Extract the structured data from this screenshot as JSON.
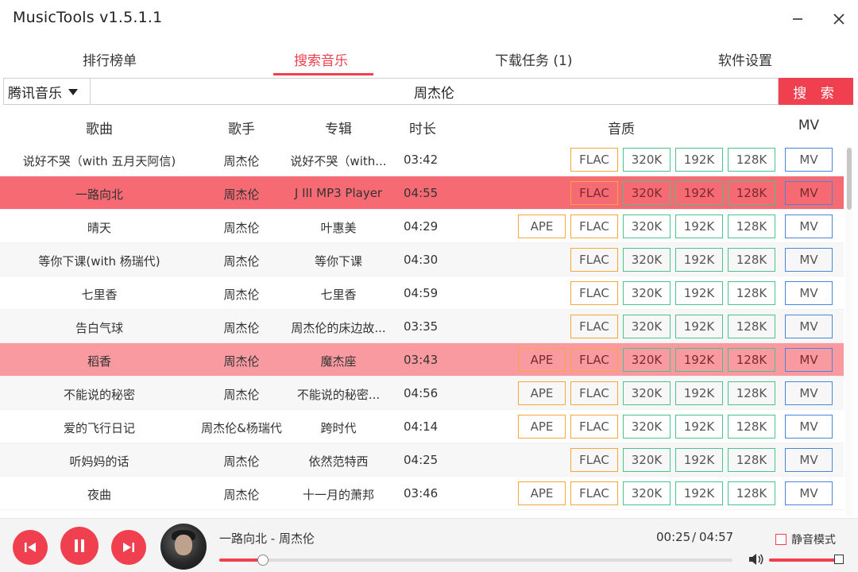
{
  "app": {
    "title": "MusicTools v1.5.1.1"
  },
  "tabs": [
    {
      "label": "排行榜单"
    },
    {
      "label": "搜索音乐",
      "active": true
    },
    {
      "label": "下载任务 (1)"
    },
    {
      "label": "软件设置"
    }
  ],
  "search": {
    "source": "腾讯音乐",
    "query": "周杰伦",
    "button_label": "搜 索"
  },
  "columns": {
    "song": "歌曲",
    "artist": "歌手",
    "album": "专辑",
    "duration": "时长",
    "quality": "音质",
    "mv": "MV"
  },
  "quality_labels": {
    "ape": "APE",
    "flac": "FLAC",
    "q320": "320K",
    "q192": "192K",
    "q128": "128K",
    "mv": "MV"
  },
  "songs": [
    {
      "song": "说好不哭（with 五月天阿信)",
      "artist": "周杰伦",
      "album": "说好不哭（with...",
      "duration": "03:42",
      "ape": false,
      "highlight": "none"
    },
    {
      "song": "一路向北",
      "artist": "周杰伦",
      "album": "J III MP3 Player",
      "duration": "04:55",
      "ape": false,
      "highlight": "strong"
    },
    {
      "song": "晴天",
      "artist": "周杰伦",
      "album": "叶惠美",
      "duration": "04:29",
      "ape": true,
      "highlight": "none"
    },
    {
      "song": "等你下课(with 杨瑞代)",
      "artist": "周杰伦",
      "album": "等你下课",
      "duration": "04:30",
      "ape": false,
      "highlight": "none"
    },
    {
      "song": "七里香",
      "artist": "周杰伦",
      "album": "七里香",
      "duration": "04:59",
      "ape": false,
      "highlight": "none"
    },
    {
      "song": "告白气球",
      "artist": "周杰伦",
      "album": "周杰伦的床边故...",
      "duration": "03:35",
      "ape": false,
      "highlight": "none"
    },
    {
      "song": "稻香",
      "artist": "周杰伦",
      "album": "魔杰座",
      "duration": "03:43",
      "ape": true,
      "highlight": "light"
    },
    {
      "song": "不能说的秘密",
      "artist": "周杰伦",
      "album": "不能说的秘密...",
      "duration": "04:56",
      "ape": true,
      "highlight": "none"
    },
    {
      "song": "爱的飞行日记",
      "artist": "周杰伦&杨瑞代",
      "album": "跨时代",
      "duration": "04:14",
      "ape": true,
      "highlight": "none"
    },
    {
      "song": "听妈妈的话",
      "artist": "周杰伦",
      "album": "依然范特西",
      "duration": "04:25",
      "ape": false,
      "highlight": "none"
    },
    {
      "song": "夜曲",
      "artist": "周杰伦",
      "album": "十一月的萧邦",
      "duration": "03:46",
      "ape": true,
      "highlight": "none"
    }
  ],
  "player": {
    "now_playing": "一路向北 - 周杰伦",
    "current_time": "00:25",
    "separator": "/",
    "total_time": "04:57",
    "progress": 0.085,
    "mute_label": "静音模式",
    "mute_checked": false,
    "volume": 1.0
  },
  "colors": {
    "accent": "#f0404f",
    "highlight_strong": "#f56a73",
    "highlight_light": "#f99aa1",
    "lossless_border": "#f2a93b",
    "lossy_border": "#4cc38a",
    "mv_border": "#4a86d8"
  }
}
